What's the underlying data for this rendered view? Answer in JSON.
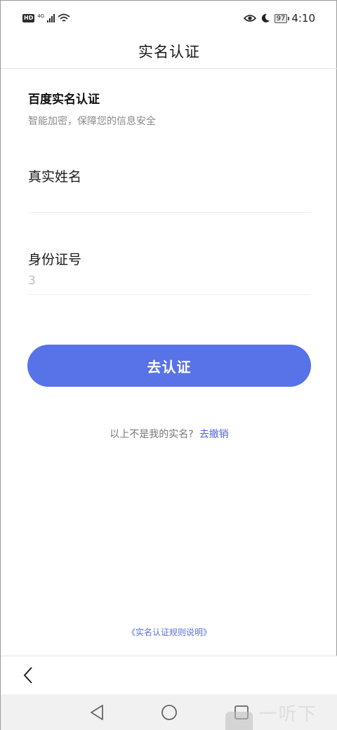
{
  "status_bar": {
    "hd": "HD",
    "network": "4G",
    "battery": "97",
    "time": "4:10",
    "icons": [
      "signal-icon",
      "wifi-icon",
      "eye-icon",
      "moon-icon",
      "battery-icon"
    ]
  },
  "header": {
    "title": "实名认证"
  },
  "section": {
    "title": "百度实名认证",
    "subtitle": "智能加密，保障您的信息安全"
  },
  "form": {
    "name_label": "真实姓名",
    "name_value": "",
    "id_label": "身份证号",
    "id_placeholder": "3",
    "id_value": ""
  },
  "submit": {
    "label": "去认证"
  },
  "revoke": {
    "question": "以上不是我的实名?",
    "link": "去撤销"
  },
  "rules": {
    "link": "《实名认证规则说明》"
  },
  "watermark": {
    "text": "一听下载"
  },
  "colors": {
    "accent": "#5872e8",
    "link": "#4f66d8"
  }
}
